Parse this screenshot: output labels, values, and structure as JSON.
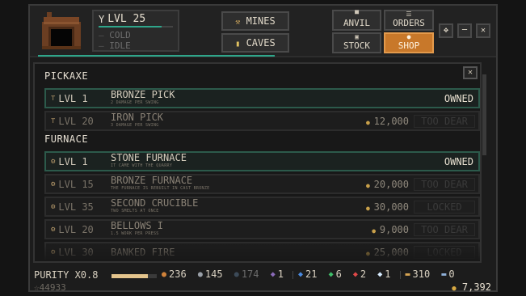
{
  "status": {
    "level_label": "LVL 25",
    "level_progress": 0.85,
    "temperature": "COLD",
    "activity": "IDLE"
  },
  "nav": {
    "mines": "MINES",
    "caves": "CAVES",
    "anvil": "ANVIL",
    "orders": "ORDERS",
    "stock": "STOCK",
    "shop": "SHOP",
    "active_tab": "SHOP"
  },
  "window_controls": {
    "settings": "✥",
    "minimize": "─",
    "close": "✕"
  },
  "shop": {
    "close_glyph": "✕",
    "sections": [
      {
        "title": "PICKAXE",
        "items": [
          {
            "level": "LVL 1",
            "name": "BRONZE PICK",
            "sub": "2 DAMAGE PER SWING",
            "price": "",
            "state": "OWNED"
          },
          {
            "level": "LVL 20",
            "name": "IRON PICK",
            "sub": "3 DAMAGE PER SWING",
            "price": "12,000",
            "state": "TOO DEAR"
          }
        ]
      },
      {
        "title": "FURNACE",
        "items": [
          {
            "level": "LVL 1",
            "name": "STONE FURNACE",
            "sub": "IT CAME WITH THE QUARRY",
            "price": "",
            "state": "OWNED"
          },
          {
            "level": "LVL 15",
            "name": "BRONZE FURNACE",
            "sub": "THE FURNACE IS REBUILT IN CAST BRONZE",
            "price": "20,000",
            "state": "TOO DEAR"
          },
          {
            "level": "LVL 35",
            "name": "SECOND CRUCIBLE",
            "sub": "TWO SMELTS AT ONCE",
            "price": "30,000",
            "state": "LOCKED"
          },
          {
            "level": "LVL 20",
            "name": "BELLOWS I",
            "sub": "1.5 WORK PER PRESS",
            "price": "9,000",
            "state": "TOO DEAR"
          },
          {
            "level": "LVL 30",
            "name": "BANKED FIRE",
            "sub": "",
            "price": "25,000",
            "state": "LOCKED"
          }
        ]
      }
    ]
  },
  "footer": {
    "purity": "PURITY X0.8",
    "purity_fill": 0.8,
    "resources": [
      {
        "icon": "copper-ore-icon",
        "glyph": "●",
        "color": "#d0823a",
        "value": "236"
      },
      {
        "icon": "iron-ore-icon",
        "glyph": "●",
        "color": "#9aa0a8",
        "value": "145"
      },
      {
        "icon": "coal-icon",
        "glyph": "●",
        "color": "#3c4a58",
        "value": "174"
      },
      {
        "icon": "amethyst-icon",
        "glyph": "◆",
        "color": "#8a6ab8",
        "value": "1"
      },
      {
        "icon": "sapphire-icon",
        "glyph": "◆",
        "color": "#4a8ae0",
        "value": "21"
      },
      {
        "icon": "emerald-icon",
        "glyph": "◆",
        "color": "#3fbf6a",
        "value": "6"
      },
      {
        "icon": "ruby-icon",
        "glyph": "◆",
        "color": "#e04848",
        "value": "2"
      },
      {
        "icon": "diamond-icon",
        "glyph": "◆",
        "color": "#d8ecff",
        "value": "1"
      },
      {
        "icon": "bronze-ingot-icon",
        "glyph": "▬",
        "color": "#d6a452",
        "value": "310"
      },
      {
        "icon": "iron-ingot-icon",
        "glyph": "▬",
        "color": "#8fb0d8",
        "value": "0"
      }
    ],
    "stars": "44933",
    "gold": "7,392"
  }
}
